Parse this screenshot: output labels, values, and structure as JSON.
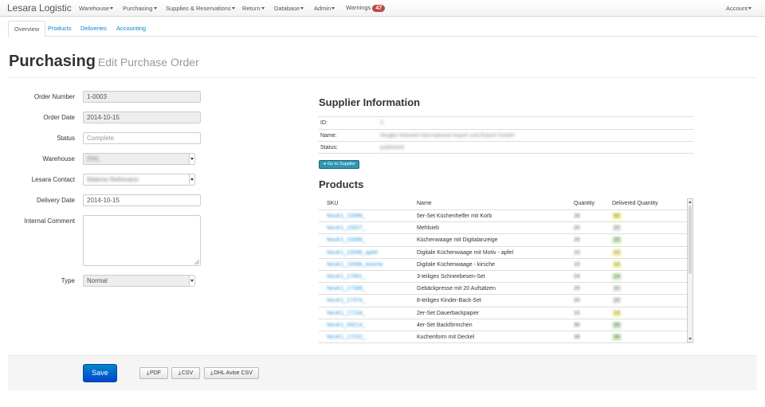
{
  "navbar": {
    "brand": "Lesara Logistic",
    "menus": [
      "Warehouse",
      "Purchasing",
      "Supplies & Reservations",
      "Return",
      "Database",
      "Admin"
    ],
    "warnings_label": "Warnings",
    "warnings_count": "47",
    "account_label": "Account"
  },
  "tabs": [
    "Overview",
    "Products",
    "Deliveries",
    "Accounting"
  ],
  "page": {
    "title": "Purchasing",
    "subtitle": "Edit Purchase Order"
  },
  "form": {
    "order_number": {
      "label": "Order Number",
      "value": "1-0003"
    },
    "order_date": {
      "label": "Order Date",
      "value": "2014-10-15"
    },
    "status": {
      "label": "Status",
      "placeholder": "Complete"
    },
    "warehouse": {
      "label": "Warehouse",
      "value": "DHL"
    },
    "lesara_contact": {
      "label": "Lesara Contact",
      "value": "Malena Reihmann"
    },
    "delivery_date": {
      "label": "Delivery Date",
      "value": "2014-10-15"
    },
    "internal_comment": {
      "label": "Internal Comment",
      "value": ""
    },
    "type": {
      "label": "Type",
      "value": "Normal"
    }
  },
  "supplier": {
    "title": "Supplier Information",
    "rows": [
      {
        "key": "ID:",
        "value": "3"
      },
      {
        "key": "Name:",
        "value": "Ningbo Marwell International Import und Export GmbH"
      },
      {
        "key": "Status:",
        "value": "published"
      }
    ],
    "button_label": "Go to Supplier",
    "button_icon": "arrow-right-icon"
  },
  "products": {
    "title": "Products",
    "columns": [
      "SKU",
      "Name",
      "Quantity",
      "Delivered Quantity"
    ],
    "rows": [
      {
        "sku": "NeuK1_10096_",
        "name": "5er-Set Küchenhelfer mit Korb",
        "quantity": "28",
        "delivered": "50",
        "status_color": "#fcf8a0"
      },
      {
        "sku": "NeuK1_10027_",
        "name": "Mehlsieb",
        "quantity": "20",
        "delivered": "20",
        "status_color": "#f2f2f2"
      },
      {
        "sku": "NeuK1_10096_",
        "name": "Küchenwaage mit Digitalanzeige",
        "quantity": "20",
        "delivered": "20",
        "status_color": "#d6f0c8"
      },
      {
        "sku": "NeuK1_10096_apfel",
        "name": "Digitale Küchenwaage mit Motiv - apfel",
        "quantity": "10",
        "delivered": "10",
        "status_color": "#fcf8b8"
      },
      {
        "sku": "NeuK1_10096_kirsche",
        "name": "Digitale Küchenwaage - kirsche",
        "quantity": "10",
        "delivered": "10",
        "status_color": "#fcf8b8"
      },
      {
        "sku": "NeuK1_17851_",
        "name": "3-teiliges Schneebesen-Set",
        "quantity": "24",
        "delivered": "24",
        "status_color": "#d6f0c8"
      },
      {
        "sku": "NeuK1_17396_",
        "name": "Gebäckpresse mit 20 Aufsätzen",
        "quantity": "20",
        "delivered": "20",
        "status_color": "#f2f2f2"
      },
      {
        "sku": "NeuK1_17374_",
        "name": "8-teiliges Kinder-Back-Set",
        "quantity": "20",
        "delivered": "20",
        "status_color": "#f2f2f2"
      },
      {
        "sku": "NeuK1_17234_",
        "name": "2er-Set Dauerbackpapier",
        "quantity": "10",
        "delivered": "10",
        "status_color": "#fcf8b8"
      },
      {
        "sku": "NeuK1_09214_",
        "name": "4er-Set Backförmchen",
        "quantity": "30",
        "delivered": "30",
        "status_color": "#d6f0c8"
      },
      {
        "sku": "NeuK1_17232_",
        "name": "Kuchenform mit Deckel",
        "quantity": "36",
        "delivered": "36",
        "status_color": "#d6f0c8"
      }
    ]
  },
  "footer": {
    "save_label": "Save",
    "exports": [
      {
        "label": "PDF",
        "icon": "download-icon"
      },
      {
        "label": "CSV",
        "icon": "download-icon"
      },
      {
        "label": "DHL Avise CSV",
        "icon": "download-icon"
      }
    ]
  }
}
